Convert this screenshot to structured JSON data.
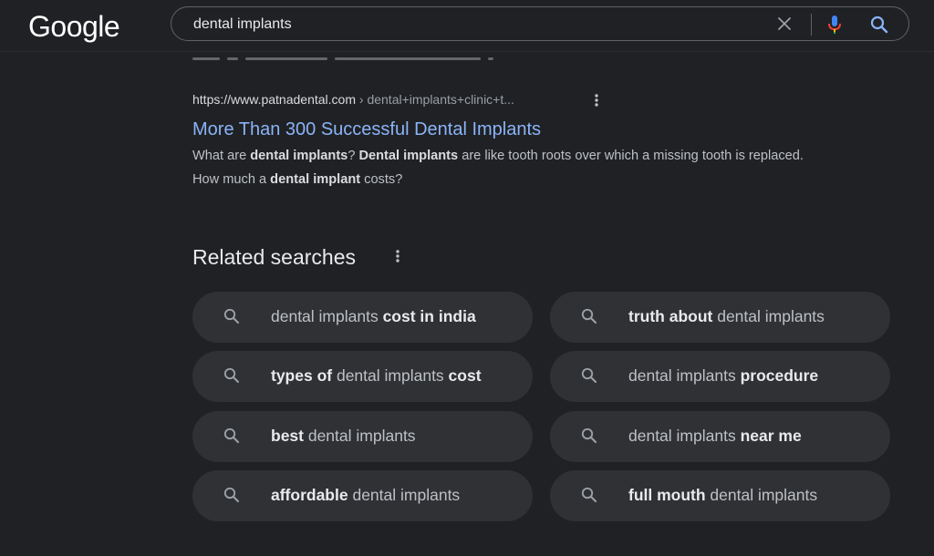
{
  "header": {
    "logo": "Google",
    "search_query": "dental implants"
  },
  "result": {
    "url_site": "https://www.patnadental.com",
    "url_path": " › dental+implants+clinic+t...",
    "title": "More Than 300 Successful Dental Implants",
    "snippet": [
      {
        "text": "What are ",
        "bold": false
      },
      {
        "text": "dental implants",
        "bold": true
      },
      {
        "text": "? ",
        "bold": false
      },
      {
        "text": "Dental implants",
        "bold": true
      },
      {
        "text": " are like tooth roots over which a missing tooth is replaced. How much a ",
        "bold": false
      },
      {
        "text": "dental implant",
        "bold": true
      },
      {
        "text": " costs?",
        "bold": false
      }
    ]
  },
  "related": {
    "title": "Related searches",
    "items": [
      {
        "parts": [
          {
            "text": "dental implants ",
            "bold": false
          },
          {
            "text": "cost in india",
            "bold": true
          }
        ]
      },
      {
        "parts": [
          {
            "text": "truth about",
            "bold": true
          },
          {
            "text": " dental implants",
            "bold": false
          }
        ]
      },
      {
        "parts": [
          {
            "text": "types of",
            "bold": true
          },
          {
            "text": " dental implants ",
            "bold": false
          },
          {
            "text": "cost",
            "bold": true
          }
        ]
      },
      {
        "parts": [
          {
            "text": "dental implants ",
            "bold": false
          },
          {
            "text": "procedure",
            "bold": true
          }
        ]
      },
      {
        "parts": [
          {
            "text": "best",
            "bold": true
          },
          {
            "text": " dental implants",
            "bold": false
          }
        ]
      },
      {
        "parts": [
          {
            "text": "dental implants ",
            "bold": false
          },
          {
            "text": "near me",
            "bold": true
          }
        ]
      },
      {
        "parts": [
          {
            "text": "affordable",
            "bold": true
          },
          {
            "text": " dental implants",
            "bold": false
          }
        ]
      },
      {
        "parts": [
          {
            "text": "full mouth",
            "bold": true
          },
          {
            "text": " dental implants",
            "bold": false
          }
        ]
      }
    ]
  },
  "icons": {
    "clear": "close-icon",
    "mic": "microphone-icon",
    "search": "search-icon",
    "more": "more-vertical-icon"
  },
  "colors": {
    "background": "#202124",
    "link": "#8ab4f8",
    "chip": "#303134",
    "text": "#bdc1c6",
    "mic_blue": "#4285f4",
    "mic_red": "#ea4335",
    "search_icon": "#8ab4f8"
  }
}
